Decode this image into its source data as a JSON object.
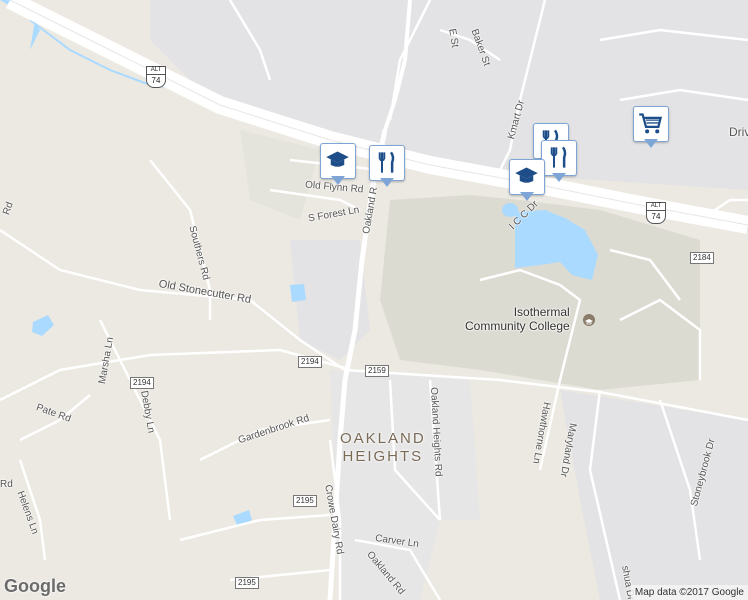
{
  "map": {
    "place_label": "OAKLAND\nHEIGHTS",
    "poi_label": "Isothermal\nCommunity College",
    "roads": {
      "old_flynn": "Old Flynn Rd",
      "s_forest": "S Forest Ln",
      "oakland_rd_top": "Oakland R",
      "southers": "Southers Rd",
      "old_stonecutter": "Old Stonecutter Rd",
      "marsha": "Marsha Ln",
      "pate": "Pate Rd",
      "debby": "Debby Ln",
      "gardenbrook": "Gardenbrook Rd",
      "helens": "Helens Ln",
      "crowe_dairy": "Crowe Dairy Rd",
      "carver": "Carver Ln",
      "oakland_rd_bottom": "Oakland Rd",
      "oakland_heights": "Oakland Heights Rd",
      "hawthorne": "Hawthorne Ln",
      "maryland": "Maryland Dr",
      "stoneybrook": "Stoneybrook Dr",
      "kmart": "Kmart Dr",
      "icc": "I C C Dr",
      "baker": "Baker St",
      "e_st": "E St",
      "drive_partial": "Driv",
      "left_rd": "Rd",
      "left_rd2": "Rd",
      "shua": "shua Dr"
    },
    "route_shields": [
      "2194",
      "2159",
      "2194",
      "2195",
      "2195",
      "2184"
    ],
    "us_shields": [
      {
        "alt": "ALT",
        "num": "74"
      },
      {
        "alt": "ALT",
        "num": "74"
      }
    ],
    "markers": [
      {
        "type": "school",
        "icon": "graduation-cap-icon"
      },
      {
        "type": "restaurant",
        "icon": "fork-knife-icon"
      },
      {
        "type": "restaurant",
        "icon": "fork-knife-icon"
      },
      {
        "type": "restaurant",
        "icon": "fork-knife-icon"
      },
      {
        "type": "school",
        "icon": "graduation-cap-icon"
      },
      {
        "type": "shopping",
        "icon": "shopping-cart-icon"
      }
    ],
    "colors": {
      "land": "#ece9e2",
      "urban": "#e2e2e4",
      "campus": "#dcdbd2",
      "water": "#aadaff",
      "highway": "#ffffff",
      "marker_border": "#7ea5d6",
      "marker_icon": "#1d4e89"
    }
  },
  "footer": {
    "logo": "Google",
    "attribution": "Map data ©2017 Google"
  }
}
